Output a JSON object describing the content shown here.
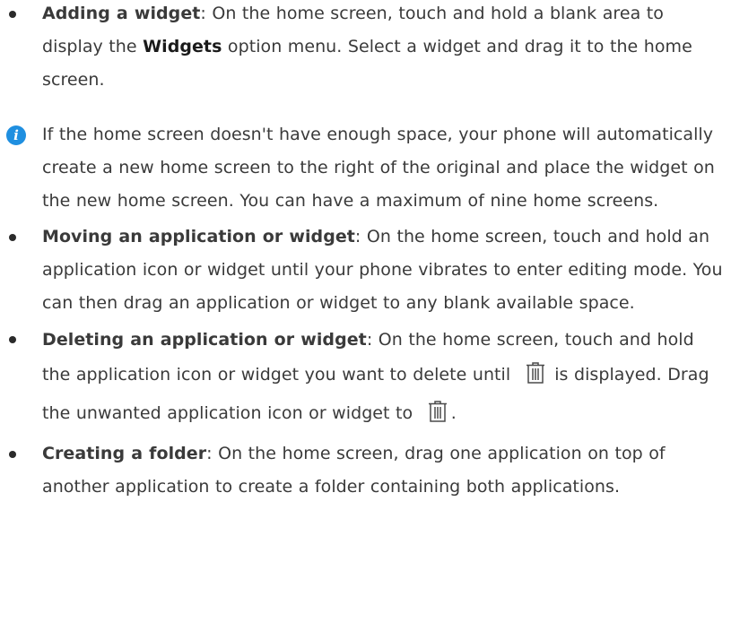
{
  "items": [
    {
      "title": "Adding a widget",
      "text_1": ": On the home screen, touch and hold a blank area to display the ",
      "menu": "Widgets",
      "text_2": " option menu. Select a widget and drag it to the home screen."
    },
    {
      "title": "Moving an application or widget",
      "text": ": On the home screen, touch and hold an application icon or widget until your phone vibrates to enter editing mode. You can then drag an application or widget to any blank available space."
    },
    {
      "title": "Deleting an application or widget",
      "text_1": ": On the home screen, touch and hold the application icon or widget you want to delete until ",
      "text_2": " is displayed. Drag the unwanted application icon or widget to ",
      "text_3": "."
    },
    {
      "title": "Creating a folder",
      "text": ": On the home screen, drag one application on top of another application to create a folder containing both applications."
    }
  ],
  "note": {
    "icon": "info-icon",
    "text": "If the home screen doesn't have enough space, your phone will automatically create a new home screen to the right of the original and place the widget on the new home screen. You can have a maximum of nine home screens."
  },
  "icons": {
    "trash": "trash-icon"
  },
  "colors": {
    "text": "#3a3a3a",
    "info": "#1f8fe0",
    "bullet": "#2b2b2b"
  }
}
